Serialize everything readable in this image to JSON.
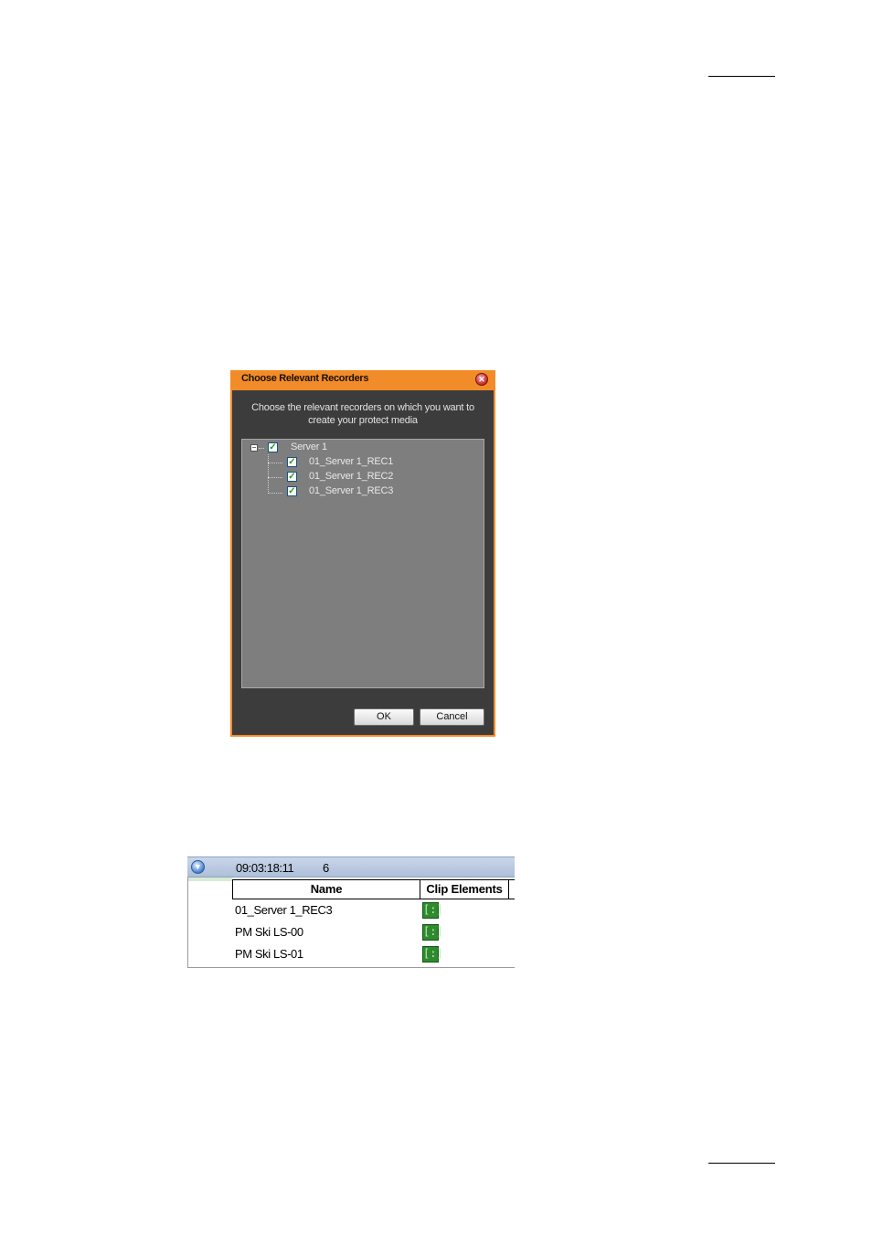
{
  "dialog": {
    "title": "Choose Relevant Recorders",
    "close_icon": "close-icon",
    "prompt_line1": "Choose the relevant recorders on which you want to",
    "prompt_line2": "create your protect media",
    "tree": {
      "root": {
        "label": "Server 1",
        "checked": true,
        "expanded": true
      },
      "children": [
        {
          "label": "01_Server 1_REC1",
          "checked": true
        },
        {
          "label": "01_Server 1_REC2",
          "checked": true
        },
        {
          "label": "01_Server 1_REC3",
          "checked": true
        }
      ]
    },
    "ok_label": "OK",
    "cancel_label": "Cancel"
  },
  "clip_table": {
    "group_time": "09:03:18:11",
    "group_count": "6",
    "columns": [
      "Name",
      "Clip Elements"
    ],
    "rows": [
      {
        "name": "01_Server 1_REC3",
        "clip_icon": "clip-elements-icon"
      },
      {
        "name": "PM Ski LS-00",
        "clip_icon": "clip-elements-icon"
      },
      {
        "name": "PM Ski LS-01",
        "clip_icon": "clip-elements-icon"
      }
    ]
  },
  "colors": {
    "dialog_frame": "#f28c28",
    "dialog_body": "#3c3c3c",
    "tree_background": "#7e7e7e",
    "group_header": "#aebfd9",
    "clip_icon": "#2f8a2f"
  }
}
